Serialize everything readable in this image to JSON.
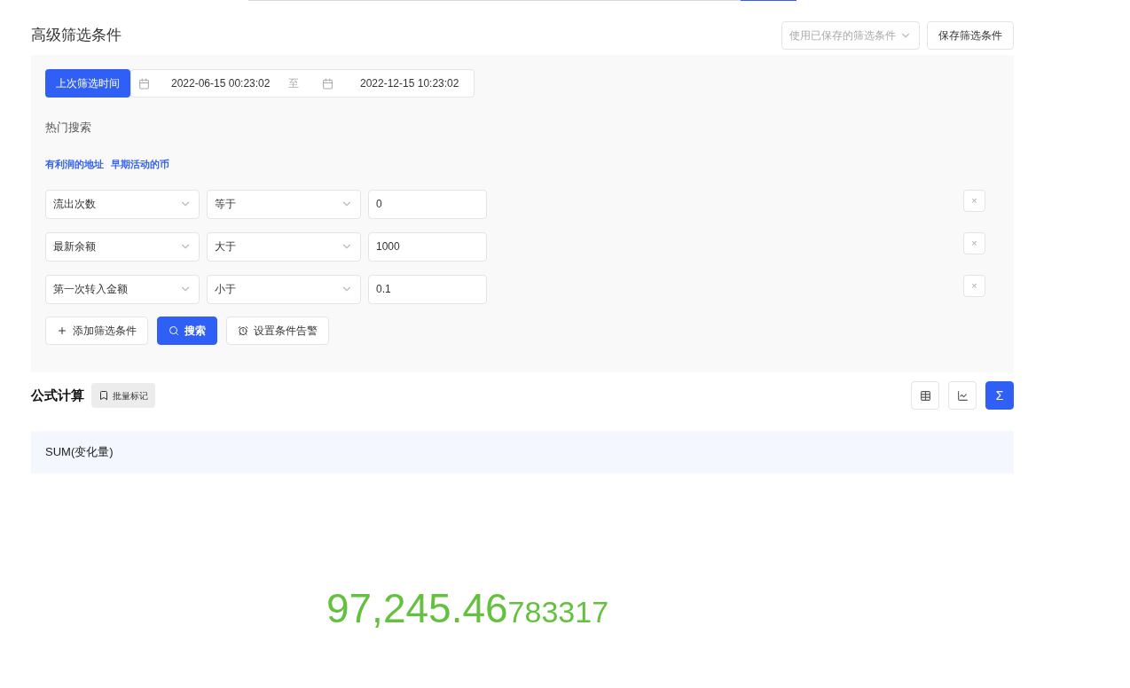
{
  "title": "高级筛选条件",
  "saved_filter_select": {
    "placeholder": "使用已保存的筛选条件"
  },
  "save_button": "保存筛选条件",
  "time_filter": {
    "button": "上次筛选时间",
    "start": "2022-06-15 00:23:02",
    "separator": "至",
    "end": "2022-12-15 10:23:02"
  },
  "hot_search": {
    "label": "热门搜索",
    "links": [
      "有利润的地址",
      "早期活动的币"
    ]
  },
  "conditions": [
    {
      "field": "流出次数",
      "operator": "等于",
      "value": "0"
    },
    {
      "field": "最新余额",
      "operator": "大于",
      "value": "1000"
    },
    {
      "field": "第一次转入金额",
      "operator": "小于",
      "value": "0.1"
    }
  ],
  "remove_symbol": "×",
  "actions": [
    {
      "kind": "add",
      "label": "添加筛选条件"
    },
    {
      "kind": "search",
      "label": "搜索"
    },
    {
      "kind": "alarm",
      "label": "设置条件告警"
    }
  ],
  "formula": {
    "title": "公式计算",
    "tag": "批量标记",
    "views": [
      {
        "kind": "table",
        "selected": false
      },
      {
        "kind": "chart",
        "selected": false
      },
      {
        "kind": "sum",
        "label": "Σ",
        "selected": true
      }
    ],
    "expression": "SUM(变化量)",
    "result_main": "97,245.46",
    "result_tail": "783317"
  }
}
